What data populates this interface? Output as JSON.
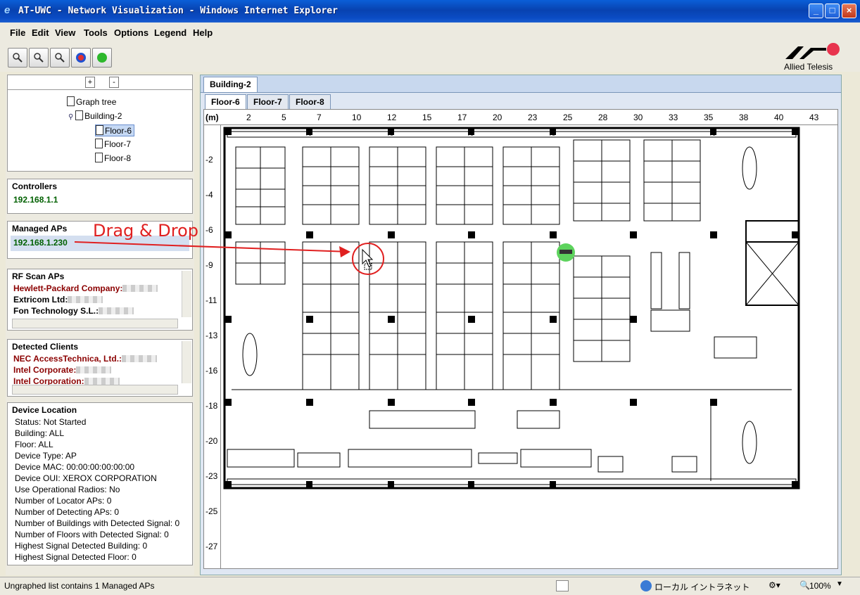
{
  "window": {
    "title": "AT-UWC - Network Visualization - Windows Internet Explorer"
  },
  "menu": [
    "File",
    "Edit",
    "View",
    "Tools",
    "Options",
    "Legend",
    "Help"
  ],
  "toolbar": {
    "buttons": [
      "zoom-in-icon",
      "zoom-out-icon",
      "zoom-fit-icon",
      "refresh-icon",
      "status-icon"
    ]
  },
  "logo": {
    "text": "Allied Telesis"
  },
  "tree": {
    "expand_label": "+",
    "collapse_label": "-",
    "root": "Graph tree",
    "building": "Building-2",
    "floors": [
      "Floor-6",
      "Floor-7",
      "Floor-8"
    ],
    "selected_floor": "Floor-6"
  },
  "controllers": {
    "title": "Controllers",
    "items": [
      "192.168.1.1"
    ]
  },
  "managed_aps": {
    "title": "Managed APs",
    "items": [
      "192.168.1.230"
    ]
  },
  "rf_scan_aps": {
    "title": "RF Scan APs",
    "items": [
      "Hewlett-Packard Company:",
      "Extricom Ltd:",
      "Fon Technology S.L.:"
    ]
  },
  "detected_clients": {
    "title": "Detected Clients",
    "items": [
      "NEC AccessTechnica, Ltd.:",
      "Intel Corporate:",
      "Intel Corporation:"
    ]
  },
  "device_location": {
    "title": "Device Location",
    "rows": [
      "Status: Not Started",
      "Building: ALL",
      "Floor: ALL",
      "Device Type: AP",
      "Device MAC: 00:00:00:00:00:00",
      "Device OUI: XEROX CORPORATION",
      "Use Operational Radios: No",
      "Number of Locator APs: 0",
      "Number of Detecting APs: 0",
      "Number of Buildings with Detected Signal: 0",
      "Number of Floors with Detected Signal: 0",
      "Highest Signal Detected Building: 0",
      "Highest Signal Detected Floor: 0"
    ]
  },
  "building_tab": "Building-2",
  "floor_tabs": [
    "Floor-6",
    "Floor-7",
    "Floor-8"
  ],
  "ruler": {
    "unit": "(m)",
    "x_ticks": [
      "2",
      "5",
      "7",
      "10",
      "12",
      "15",
      "17",
      "20",
      "23",
      "25",
      "28",
      "30",
      "33",
      "35",
      "38",
      "40",
      "43"
    ],
    "y_ticks": [
      "-2",
      "-4",
      "-6",
      "-9",
      "-11",
      "-13",
      "-16",
      "-18",
      "-20",
      "-23",
      "-25",
      "-27"
    ]
  },
  "annotation": {
    "text": "Drag & Drop"
  },
  "status": {
    "text": "Ungraphed list contains 1 Managed APs",
    "zone": "ローカル イントラネット",
    "zoom": "100%"
  },
  "colors": {
    "controller": "#006000",
    "rf_vendor": "#8b0000",
    "annotation": "#e02020",
    "ap_marker": "#5dd35d"
  }
}
